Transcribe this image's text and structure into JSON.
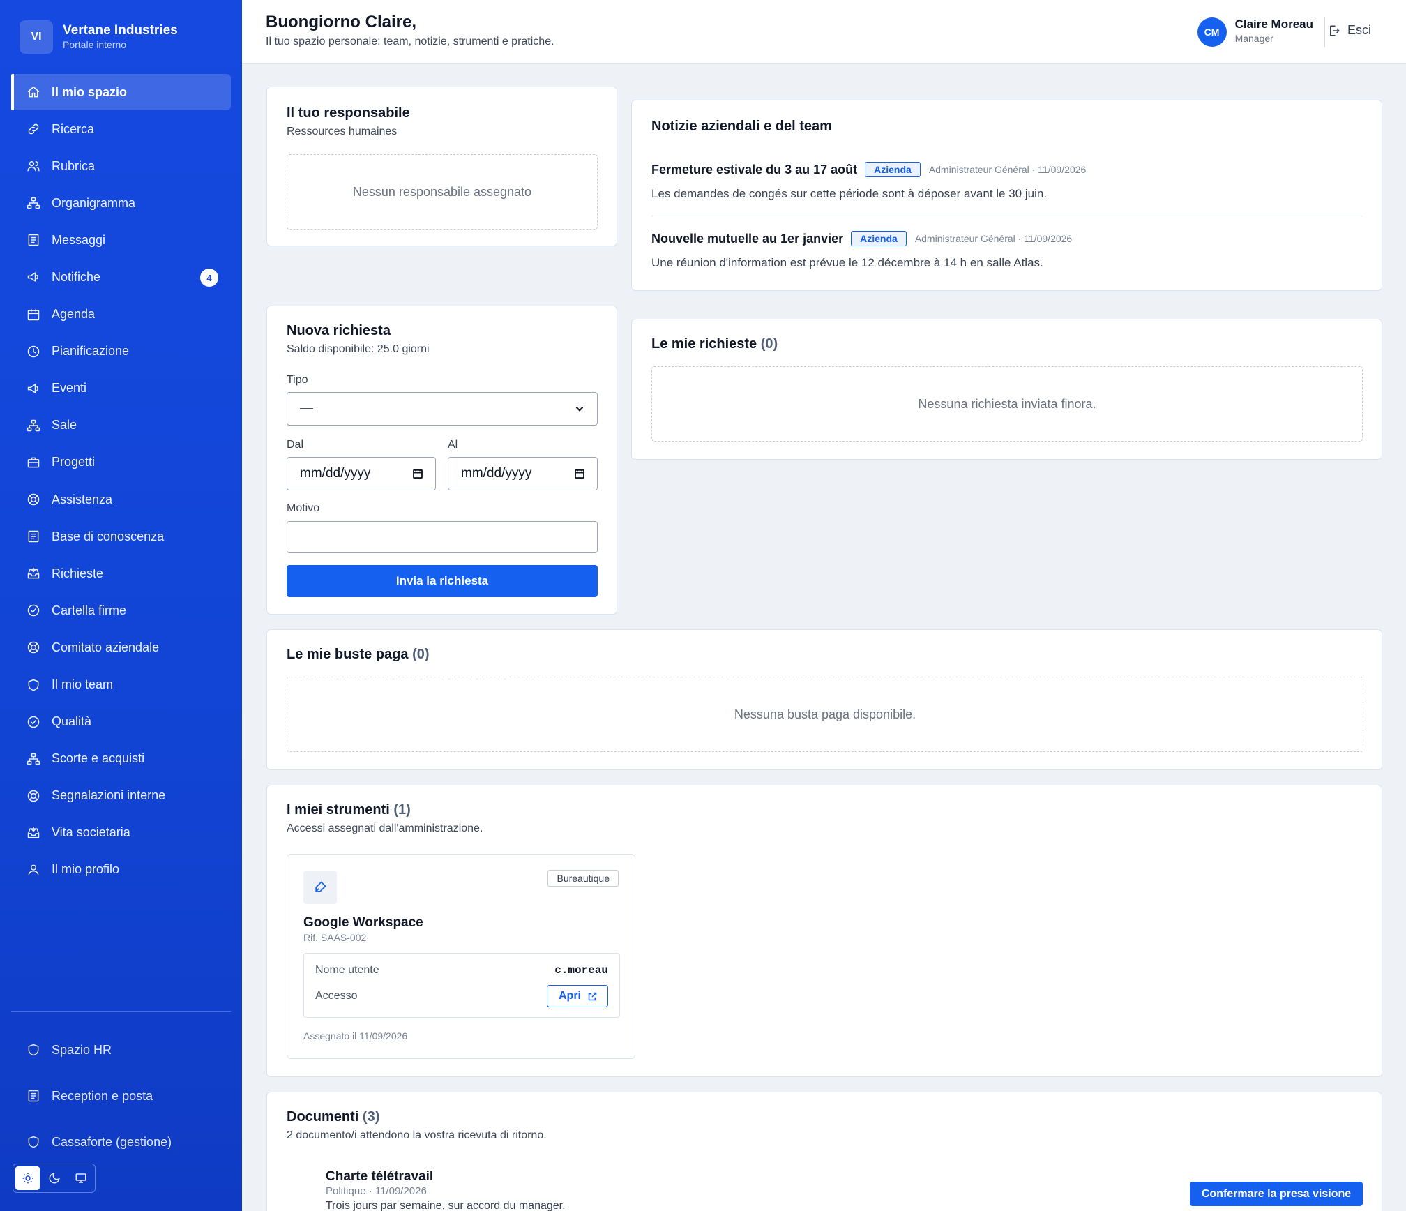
{
  "brand": {
    "initials": "VI",
    "name": "Vertane Industries",
    "subtitle": "Portale interno"
  },
  "nav": [
    {
      "label": "Il mio spazio",
      "icon": "home-icon",
      "active": true
    },
    {
      "label": "Ricerca",
      "icon": "link-icon"
    },
    {
      "label": "Rubrica",
      "icon": "users-icon"
    },
    {
      "label": "Organigramma",
      "icon": "org-chart-icon"
    },
    {
      "label": "Messaggi",
      "icon": "document-icon"
    },
    {
      "label": "Notifiche",
      "icon": "megaphone-icon",
      "badge": "4"
    },
    {
      "label": "Agenda",
      "icon": "calendar-icon"
    },
    {
      "label": "Pianificazione",
      "icon": "clock-icon"
    },
    {
      "label": "Eventi",
      "icon": "megaphone-icon"
    },
    {
      "label": "Sale",
      "icon": "org-chart-icon"
    },
    {
      "label": "Progetti",
      "icon": "briefcase-icon"
    },
    {
      "label": "Assistenza",
      "icon": "lifebuoy-icon"
    },
    {
      "label": "Base di conoscenza",
      "icon": "document-icon"
    },
    {
      "label": "Richieste",
      "icon": "inbox-icon"
    },
    {
      "label": "Cartella firme",
      "icon": "check-circle-icon"
    },
    {
      "label": "Comitato aziendale",
      "icon": "lifebuoy-icon"
    },
    {
      "label": "Il mio team",
      "icon": "shield-icon"
    },
    {
      "label": "Qualità",
      "icon": "check-circle-icon"
    },
    {
      "label": "Scorte e acquisti",
      "icon": "org-chart-icon"
    },
    {
      "label": "Segnalazioni interne",
      "icon": "lifebuoy-icon"
    },
    {
      "label": "Vita societaria",
      "icon": "inbox-icon"
    },
    {
      "label": "Il mio profilo",
      "icon": "user-icon"
    }
  ],
  "nav_bottom": [
    {
      "label": "Spazio HR",
      "icon": "shield-icon"
    },
    {
      "label": "Reception e posta",
      "icon": "document-icon"
    },
    {
      "label": "Cassaforte (gestione)",
      "icon": "shield-icon"
    }
  ],
  "theme": {
    "options": [
      "sun-icon",
      "moon-icon",
      "monitor-icon"
    ],
    "selected": "sun-icon"
  },
  "header": {
    "greeting": "Buongiorno Claire,",
    "subtitle": "Il tuo spazio personale: team, notizie, strumenti e pratiche.",
    "user": {
      "initials": "CM",
      "name": "Claire Moreau",
      "role": "Manager"
    },
    "logout": "Esci"
  },
  "manager": {
    "title": "Il tuo responsabile",
    "subtitle": "Ressources humaines",
    "empty": "Nessun responsabile assegnato"
  },
  "news": {
    "title": "Notizie aziendali e del team",
    "items": [
      {
        "title": "Fermeture estivale du 3 au 17 août",
        "tag": "Azienda",
        "meta": "Administrateur Général · 11/09/2026",
        "body": "Les demandes de congés sur cette période sont à déposer avant le 30 juin."
      },
      {
        "title": "Nouvelle mutuelle au 1er janvier",
        "tag": "Azienda",
        "meta": "Administrateur Général · 11/09/2026",
        "body": "Une réunion d'information est prévue le 12 décembre à 14 h en salle Atlas."
      }
    ]
  },
  "request_form": {
    "title": "Nuova richiesta",
    "balance": "Saldo disponibile: 25.0 giorni",
    "type_label": "Tipo",
    "type_value": "—",
    "from_label": "Dal",
    "from_placeholder": "mm/dd/yyyy",
    "to_label": "Al",
    "to_placeholder": "mm/dd/yyyy",
    "reason_label": "Motivo",
    "reason_value": "",
    "submit": "Invia la richiesta"
  },
  "my_requests": {
    "title": "Le mie richieste",
    "count": "(0)",
    "empty": "Nessuna richiesta inviata finora."
  },
  "payslips": {
    "title": "Le mie buste paga",
    "count": "(0)",
    "empty": "Nessuna busta paga disponibile."
  },
  "tools": {
    "title": "I miei strumenti",
    "count": "(1)",
    "subtitle": "Accessi assegnati dall'amministrazione.",
    "items": [
      {
        "icon": "pen-icon",
        "category": "Bureautique",
        "name": "Google Workspace",
        "ref": "Rif. SAAS-002",
        "username_label": "Nome utente",
        "username": "c.moreau",
        "access_label": "Accesso",
        "open": "Apri",
        "assigned": "Assegnato il 11/09/2026"
      }
    ]
  },
  "documents": {
    "title": "Documenti",
    "count": "(3)",
    "subtitle": "2 documento/i attendono la vostra ricevuta di ritorno.",
    "items": [
      {
        "title": "Charte télétravail",
        "meta": "Politique · 11/09/2026",
        "body": "Trois jours par semaine, sur accord du manager.",
        "action": "Confermare la presa visione"
      }
    ]
  }
}
